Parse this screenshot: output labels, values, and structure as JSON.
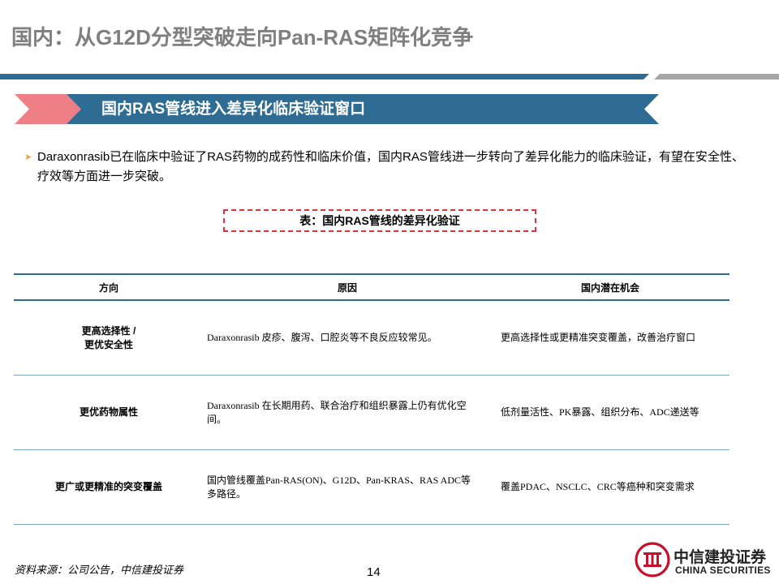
{
  "page_title": "国内：从G12D分型突破走向Pan-RAS矩阵化竞争",
  "banner": "国内RAS管线进入差异化临床验证窗口",
  "bullet_text": "Daraxonrasib已在临床中验证了RAS药物的成药性和临床价值，国内RAS管线进一步转向了差异化能力的临床验证，有望在安全性、疗效等方面进一步突破。",
  "table_caption": "表：国内RAS管线的差异化验证",
  "table": {
    "headers": [
      "方向",
      "原因",
      "国内潜在机会"
    ],
    "rows": [
      {
        "direction_lines": [
          "更高选择性 /",
          "更优安全性"
        ],
        "reason": "Daraxonrasib 皮疹、腹泻、口腔炎等不良反应较常见。",
        "opportunity": "更高选择性或更精准突变覆盖，改善治疗窗口"
      },
      {
        "direction_lines": [
          "更优药物属性"
        ],
        "reason": "Daraxonrasib 在长期用药、联合治疗和组织暴露上仍有优化空间。",
        "opportunity": "低剂量活性、PK暴露、组织分布、ADC递送等"
      },
      {
        "direction_lines": [
          "更广或更精准的突变覆盖"
        ],
        "reason": "国内管线覆盖Pan-RAS(ON)、G12D、Pan-KRAS、RAS ADC等多路径。",
        "opportunity": "覆盖PDAC、NSCLC、CRC等癌种和突变需求"
      }
    ]
  },
  "source": "资料来源：公司公告，中信建投证券",
  "page_number": "14",
  "logo": {
    "cn": "中信建投证券",
    "en": "CHINA SECURITIES",
    "color": "#c8102e"
  },
  "colors": {
    "brand_blue": "#2f6c93",
    "accent_red": "#ef7f87",
    "gray": "#a6a6a6"
  }
}
